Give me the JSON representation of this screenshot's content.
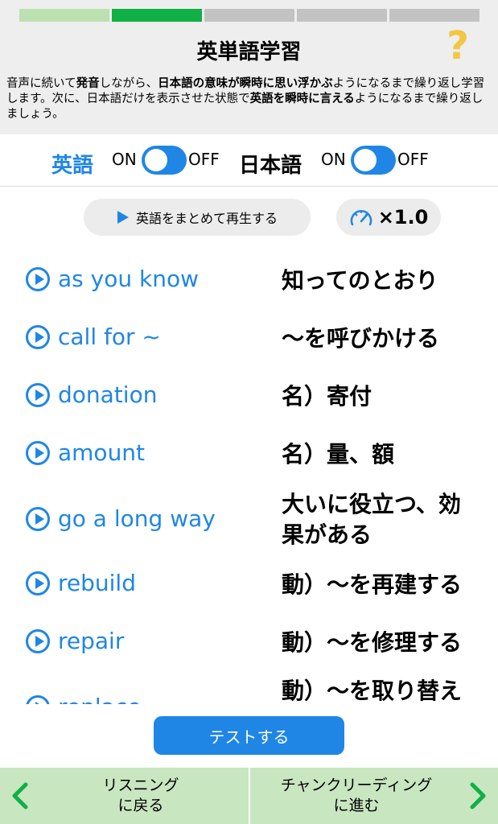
{
  "header": {
    "title": "英単語学習",
    "help_icon": "question-mark-icon",
    "progress": {
      "total_segments": 5,
      "completed": 1,
      "current": 2,
      "colors": {
        "completed": "#bde0b0",
        "current": "#10b046",
        "remaining": "#c3c3c3"
      }
    },
    "description": [
      "音声に続いて",
      "発音",
      "しながら、",
      "日本語の意味が瞬時に思い浮かぶ",
      "ようになるまで繰り返し学習します。次に、日本語だけを表示させた状態で",
      "英語を瞬時に言える",
      "ようになるまで繰り返しましょう。"
    ]
  },
  "toggles": {
    "english": {
      "label": "英語",
      "on": "ON",
      "off": "OFF",
      "state": "on"
    },
    "japanese": {
      "label": "日本語",
      "on": "ON",
      "off": "OFF",
      "state": "on"
    }
  },
  "controls": {
    "play_all_label": "英語をまとめて再生する",
    "speed_label": "×1.0"
  },
  "vocab": [
    {
      "en": "as you know",
      "jp": "知ってのとおり"
    },
    {
      "en": "call for ~",
      "jp": "～を呼びかける"
    },
    {
      "en": "donation",
      "jp": "名）寄付"
    },
    {
      "en": "amount",
      "jp": "名）量、額"
    },
    {
      "en": "go a long way",
      "jp": "大いに役立つ、効果がある"
    },
    {
      "en": "rebuild",
      "jp": "動）～を再建する"
    },
    {
      "en": "repair",
      "jp": "動）～を修理する"
    },
    {
      "en": "replace",
      "jp": "動）～を取り替え"
    }
  ],
  "test_button_label": "テストする",
  "footer": {
    "back_label_line1": "リスニング",
    "back_label_line2": "に戻る",
    "next_label_line1": "チャンクリーディング",
    "next_label_line2": "に進む",
    "chevron_color": "#10b046"
  }
}
